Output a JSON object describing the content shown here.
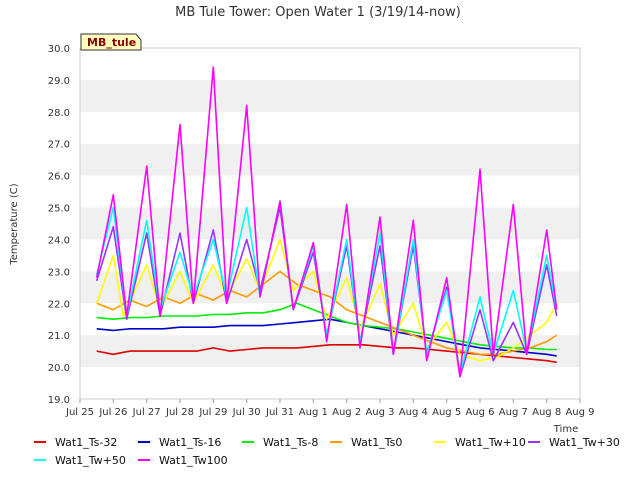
{
  "chart_data": {
    "type": "line",
    "title": "MB Tule Tower: Open Water 1 (3/19/14-now)",
    "ylabel": "Temperature (C)",
    "xlabel": "Time",
    "badge": "MB_tule",
    "ylim": [
      19.0,
      30.0
    ],
    "xlim": [
      0,
      15
    ],
    "yticks": [
      "19.0",
      "20.0",
      "21.0",
      "22.0",
      "23.0",
      "24.0",
      "25.0",
      "26.0",
      "27.0",
      "28.0",
      "29.0",
      "30.0"
    ],
    "xticks": [
      "Jul 25",
      "Jul 26",
      "Jul 27",
      "Jul 28",
      "Jul 29",
      "Jul 30",
      "Jul 31",
      "Aug 1",
      "Aug 2",
      "Aug 3",
      "Aug 4",
      "Aug 5",
      "Aug 6",
      "Aug 7",
      "Aug 8",
      "Aug 9"
    ],
    "grid": "horizontal bands",
    "legend_position": "bottom",
    "series": [
      {
        "name": "Wat1_Ts-32",
        "color": "#dd0000",
        "points": [
          [
            0.5,
            20.5
          ],
          [
            1.0,
            20.4
          ],
          [
            1.5,
            20.5
          ],
          [
            2.0,
            20.5
          ],
          [
            2.5,
            20.5
          ],
          [
            3.0,
            20.5
          ],
          [
            3.5,
            20.5
          ],
          [
            4.0,
            20.6
          ],
          [
            4.5,
            20.5
          ],
          [
            5.0,
            20.55
          ],
          [
            5.5,
            20.6
          ],
          [
            6.0,
            20.6
          ],
          [
            6.5,
            20.6
          ],
          [
            7.0,
            20.65
          ],
          [
            7.5,
            20.7
          ],
          [
            8.0,
            20.7
          ],
          [
            8.5,
            20.7
          ],
          [
            9.0,
            20.65
          ],
          [
            9.5,
            20.6
          ],
          [
            10.0,
            20.6
          ],
          [
            10.5,
            20.55
          ],
          [
            11.0,
            20.5
          ],
          [
            11.5,
            20.45
          ],
          [
            12.0,
            20.4
          ],
          [
            12.5,
            20.35
          ],
          [
            13.0,
            20.3
          ],
          [
            13.5,
            20.25
          ],
          [
            14.0,
            20.2
          ],
          [
            14.3,
            20.15
          ]
        ]
      },
      {
        "name": "Wat1_Ts-16",
        "color": "#0000cc",
        "points": [
          [
            0.5,
            21.2
          ],
          [
            1.0,
            21.15
          ],
          [
            1.5,
            21.2
          ],
          [
            2.0,
            21.2
          ],
          [
            2.5,
            21.2
          ],
          [
            3.0,
            21.25
          ],
          [
            3.5,
            21.25
          ],
          [
            4.0,
            21.25
          ],
          [
            4.5,
            21.3
          ],
          [
            5.0,
            21.3
          ],
          [
            5.5,
            21.3
          ],
          [
            6.0,
            21.35
          ],
          [
            6.5,
            21.4
          ],
          [
            7.0,
            21.45
          ],
          [
            7.5,
            21.5
          ],
          [
            8.0,
            21.4
          ],
          [
            8.5,
            21.3
          ],
          [
            9.0,
            21.2
          ],
          [
            9.5,
            21.1
          ],
          [
            10.0,
            21.0
          ],
          [
            10.5,
            20.9
          ],
          [
            11.0,
            20.8
          ],
          [
            11.5,
            20.7
          ],
          [
            12.0,
            20.6
          ],
          [
            12.5,
            20.55
          ],
          [
            13.0,
            20.5
          ],
          [
            13.5,
            20.45
          ],
          [
            14.0,
            20.4
          ],
          [
            14.3,
            20.35
          ]
        ]
      },
      {
        "name": "Wat1_Ts-8",
        "color": "#00ee00",
        "points": [
          [
            0.5,
            21.55
          ],
          [
            1.0,
            21.5
          ],
          [
            1.5,
            21.55
          ],
          [
            2.0,
            21.55
          ],
          [
            2.5,
            21.6
          ],
          [
            3.0,
            21.6
          ],
          [
            3.5,
            21.6
          ],
          [
            4.0,
            21.65
          ],
          [
            4.5,
            21.65
          ],
          [
            5.0,
            21.7
          ],
          [
            5.5,
            21.7
          ],
          [
            6.0,
            21.8
          ],
          [
            6.5,
            22.0
          ],
          [
            7.0,
            21.8
          ],
          [
            7.5,
            21.6
          ],
          [
            8.0,
            21.4
          ],
          [
            8.5,
            21.3
          ],
          [
            9.0,
            21.25
          ],
          [
            9.5,
            21.2
          ],
          [
            10.0,
            21.1
          ],
          [
            10.5,
            21.0
          ],
          [
            11.0,
            20.9
          ],
          [
            11.5,
            20.8
          ],
          [
            12.0,
            20.7
          ],
          [
            12.5,
            20.65
          ],
          [
            13.0,
            20.6
          ],
          [
            13.5,
            20.6
          ],
          [
            14.0,
            20.55
          ],
          [
            14.3,
            20.55
          ]
        ]
      },
      {
        "name": "Wat1_Ts0",
        "color": "#ff9900",
        "points": [
          [
            0.5,
            22.0
          ],
          [
            1.0,
            21.8
          ],
          [
            1.5,
            22.1
          ],
          [
            2.0,
            21.9
          ],
          [
            2.5,
            22.2
          ],
          [
            3.0,
            22.0
          ],
          [
            3.5,
            22.3
          ],
          [
            4.0,
            22.1
          ],
          [
            4.5,
            22.4
          ],
          [
            5.0,
            22.2
          ],
          [
            5.5,
            22.6
          ],
          [
            6.0,
            23.0
          ],
          [
            6.5,
            22.6
          ],
          [
            7.0,
            22.4
          ],
          [
            7.5,
            22.2
          ],
          [
            8.0,
            21.8
          ],
          [
            8.5,
            21.6
          ],
          [
            9.0,
            21.4
          ],
          [
            9.5,
            21.2
          ],
          [
            10.0,
            21.0
          ],
          [
            10.5,
            20.8
          ],
          [
            11.0,
            20.6
          ],
          [
            11.5,
            20.5
          ],
          [
            12.0,
            20.4
          ],
          [
            12.5,
            20.4
          ],
          [
            13.0,
            20.5
          ],
          [
            13.5,
            20.6
          ],
          [
            14.0,
            20.8
          ],
          [
            14.3,
            21.0
          ]
        ]
      },
      {
        "name": "Wat1_Tw+10",
        "color": "#ffff00",
        "points": [
          [
            0.5,
            22.0
          ],
          [
            1.0,
            23.5
          ],
          [
            1.3,
            21.6
          ],
          [
            2.0,
            23.2
          ],
          [
            2.4,
            21.8
          ],
          [
            3.0,
            23.0
          ],
          [
            3.4,
            22.0
          ],
          [
            4.0,
            23.2
          ],
          [
            4.4,
            22.2
          ],
          [
            5.0,
            23.4
          ],
          [
            5.4,
            22.4
          ],
          [
            6.0,
            24.0
          ],
          [
            6.4,
            22.4
          ],
          [
            7.0,
            23.0
          ],
          [
            7.4,
            21.5
          ],
          [
            8.0,
            22.8
          ],
          [
            8.4,
            21.2
          ],
          [
            9.0,
            22.6
          ],
          [
            9.4,
            21.0
          ],
          [
            10.0,
            22.0
          ],
          [
            10.4,
            20.6
          ],
          [
            11.0,
            21.4
          ],
          [
            11.4,
            20.4
          ],
          [
            12.0,
            20.2
          ],
          [
            12.5,
            20.3
          ],
          [
            13.0,
            20.6
          ],
          [
            13.5,
            21.0
          ],
          [
            14.0,
            21.4
          ],
          [
            14.3,
            22.0
          ]
        ]
      },
      {
        "name": "Wat1_Tw+30",
        "color": "#9933ff",
        "points": [
          [
            0.5,
            22.7
          ],
          [
            1.0,
            24.4
          ],
          [
            1.4,
            21.5
          ],
          [
            2.0,
            24.2
          ],
          [
            2.4,
            21.6
          ],
          [
            3.0,
            24.2
          ],
          [
            3.4,
            22.0
          ],
          [
            4.0,
            24.3
          ],
          [
            4.4,
            22.0
          ],
          [
            5.0,
            24.0
          ],
          [
            5.4,
            22.4
          ],
          [
            6.0,
            25.0
          ],
          [
            6.4,
            21.8
          ],
          [
            7.0,
            23.6
          ],
          [
            7.4,
            21.0
          ],
          [
            8.0,
            23.8
          ],
          [
            8.4,
            20.8
          ],
          [
            9.0,
            23.8
          ],
          [
            9.4,
            20.4
          ],
          [
            10.0,
            23.8
          ],
          [
            10.4,
            20.4
          ],
          [
            11.0,
            22.5
          ],
          [
            11.4,
            19.7
          ],
          [
            12.0,
            21.8
          ],
          [
            12.4,
            20.2
          ],
          [
            13.0,
            21.4
          ],
          [
            13.4,
            20.4
          ],
          [
            14.0,
            23.2
          ],
          [
            14.3,
            21.6
          ]
        ]
      },
      {
        "name": "Wat1_Tw+50",
        "color": "#00ffff",
        "points": [
          [
            0.5,
            22.9
          ],
          [
            1.0,
            25.0
          ],
          [
            1.4,
            21.6
          ],
          [
            2.0,
            24.6
          ],
          [
            2.4,
            21.8
          ],
          [
            3.0,
            23.6
          ],
          [
            3.4,
            22.2
          ],
          [
            4.0,
            24.0
          ],
          [
            4.4,
            22.2
          ],
          [
            5.0,
            25.0
          ],
          [
            5.4,
            22.2
          ],
          [
            6.0,
            25.2
          ],
          [
            6.4,
            21.8
          ],
          [
            7.0,
            23.8
          ],
          [
            7.4,
            21.0
          ],
          [
            8.0,
            24.0
          ],
          [
            8.4,
            20.8
          ],
          [
            9.0,
            24.2
          ],
          [
            9.4,
            20.4
          ],
          [
            10.0,
            24.0
          ],
          [
            10.4,
            20.4
          ],
          [
            11.0,
            22.4
          ],
          [
            11.4,
            19.8
          ],
          [
            12.0,
            22.2
          ],
          [
            12.4,
            20.4
          ],
          [
            13.0,
            22.4
          ],
          [
            13.4,
            20.5
          ],
          [
            14.0,
            23.5
          ],
          [
            14.3,
            21.8
          ]
        ]
      },
      {
        "name": "Wat1_Tw100",
        "color": "#ff00ff",
        "points": [
          [
            0.5,
            22.8
          ],
          [
            1.0,
            25.4
          ],
          [
            1.4,
            21.6
          ],
          [
            2.0,
            26.3
          ],
          [
            2.4,
            21.6
          ],
          [
            3.0,
            27.6
          ],
          [
            3.4,
            22.0
          ],
          [
            4.0,
            29.4
          ],
          [
            4.4,
            22.0
          ],
          [
            5.0,
            28.2
          ],
          [
            5.4,
            22.2
          ],
          [
            6.0,
            25.2
          ],
          [
            6.4,
            21.8
          ],
          [
            7.0,
            23.9
          ],
          [
            7.4,
            20.8
          ],
          [
            8.0,
            25.1
          ],
          [
            8.4,
            20.6
          ],
          [
            9.0,
            24.7
          ],
          [
            9.4,
            20.4
          ],
          [
            10.0,
            24.6
          ],
          [
            10.4,
            20.2
          ],
          [
            11.0,
            22.8
          ],
          [
            11.4,
            19.7
          ],
          [
            12.0,
            26.2
          ],
          [
            12.4,
            20.4
          ],
          [
            13.0,
            25.1
          ],
          [
            13.4,
            20.4
          ],
          [
            14.0,
            24.3
          ],
          [
            14.3,
            21.8
          ]
        ]
      }
    ]
  }
}
